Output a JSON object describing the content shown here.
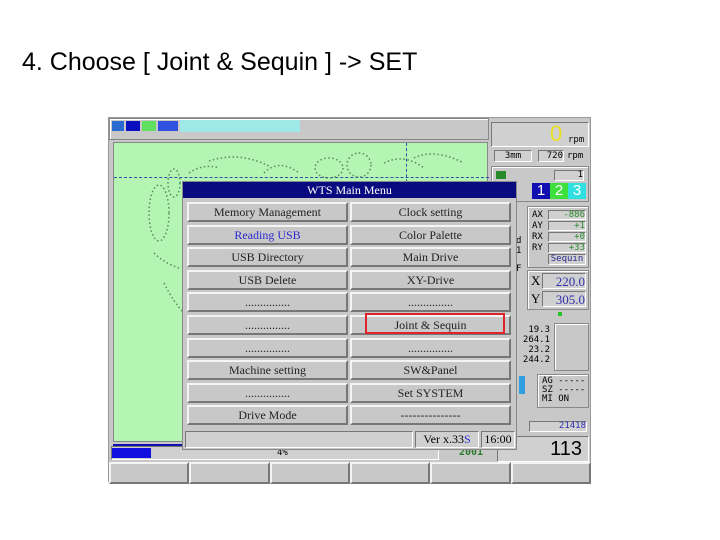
{
  "heading": "4. Choose [ Joint & Sequin ] -> SET",
  "menu": {
    "title": "WTS Main Menu",
    "left": [
      "Memory Management",
      "Reading USB",
      "USB Directory",
      "USB Delete",
      "...............",
      "...............",
      "...............",
      "Machine setting",
      "...............",
      "Drive Mode"
    ],
    "right": [
      "Clock setting",
      "Color Palette",
      "Main Drive",
      "XY-Drive",
      "...............",
      "Joint & Sequin",
      "...............",
      "SW&Panel",
      "Set SYSTEM",
      "---------------"
    ],
    "selected_left": "Reading USB",
    "highlighted": "Joint & Sequin",
    "version": "Ver x.33",
    "version_suffix": "S",
    "time": "16:00"
  },
  "right_panel": {
    "speed": "0",
    "speed_unit": "rpm",
    "stitch_len": "3mm",
    "max_speed": "720",
    "max_unit": "rpm",
    "needle_no": "1",
    "heads": [
      "1",
      "2",
      "3"
    ],
    "coords": [
      {
        "label": "AX",
        "value": "-886"
      },
      {
        "label": "AY",
        "value": "+1"
      },
      {
        "label": "RX",
        "value": "+0"
      },
      {
        "label": "RY",
        "value": "+33"
      }
    ],
    "mode": "Sequin",
    "x_label": "X",
    "x_value": "220.0",
    "y_label": "Y",
    "y_value": "305.0",
    "stats": [
      "19.3",
      "264.1",
      "23.2",
      "244.2"
    ],
    "ag": "AG -----",
    "sz": "SZ -----",
    "mi": "MI ON",
    "stitch_count": "21418",
    "big_number": "113",
    "partial": [
      "d",
      "1",
      "F"
    ]
  },
  "bottom": {
    "progress_label": "4%",
    "progress": 4,
    "code": "2001"
  },
  "colors": {
    "menu_title_bg": "#0a0a80",
    "pattern_bg": "#b4f5b4",
    "highlight": "#e0222a",
    "accent_blue": "#2a2ad0"
  }
}
